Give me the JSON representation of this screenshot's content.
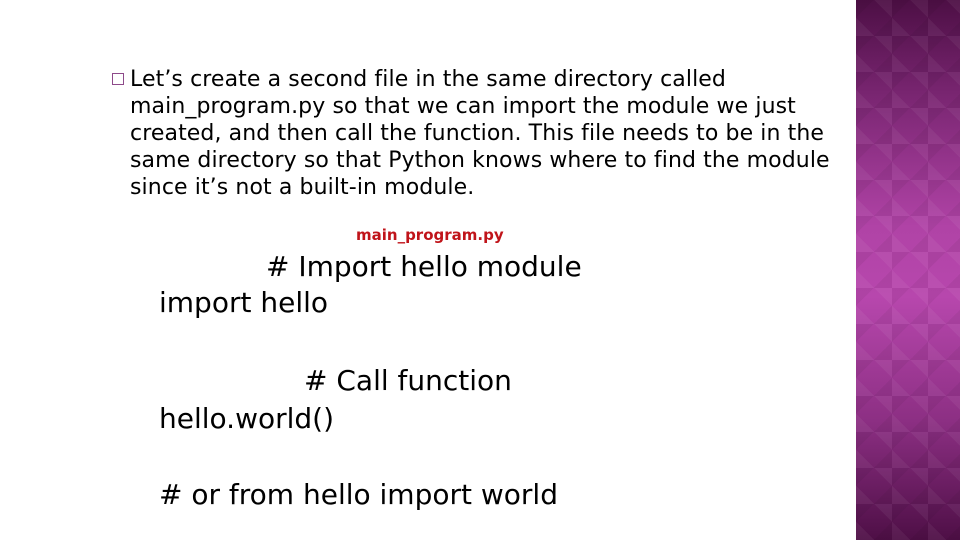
{
  "slide": {
    "bullet": {
      "icon": "hollow-square-bullet-icon",
      "text": "Let’s create a second file in the same directory called main_program.py so that we can import the module we just created, and then call the function. This file needs to be in the same directory so that Python knows where to find the module since it’s not a built-in module."
    },
    "file_label": "main_program.py",
    "code_lines": [
      "# Import hello module",
      "import hello",
      "# Call function",
      "hello.world()",
      "# or from hello import world"
    ]
  },
  "colors": {
    "accent_panel": "#b043a6",
    "file_label": "#c0141a",
    "bullet": "#8e4a8a"
  }
}
